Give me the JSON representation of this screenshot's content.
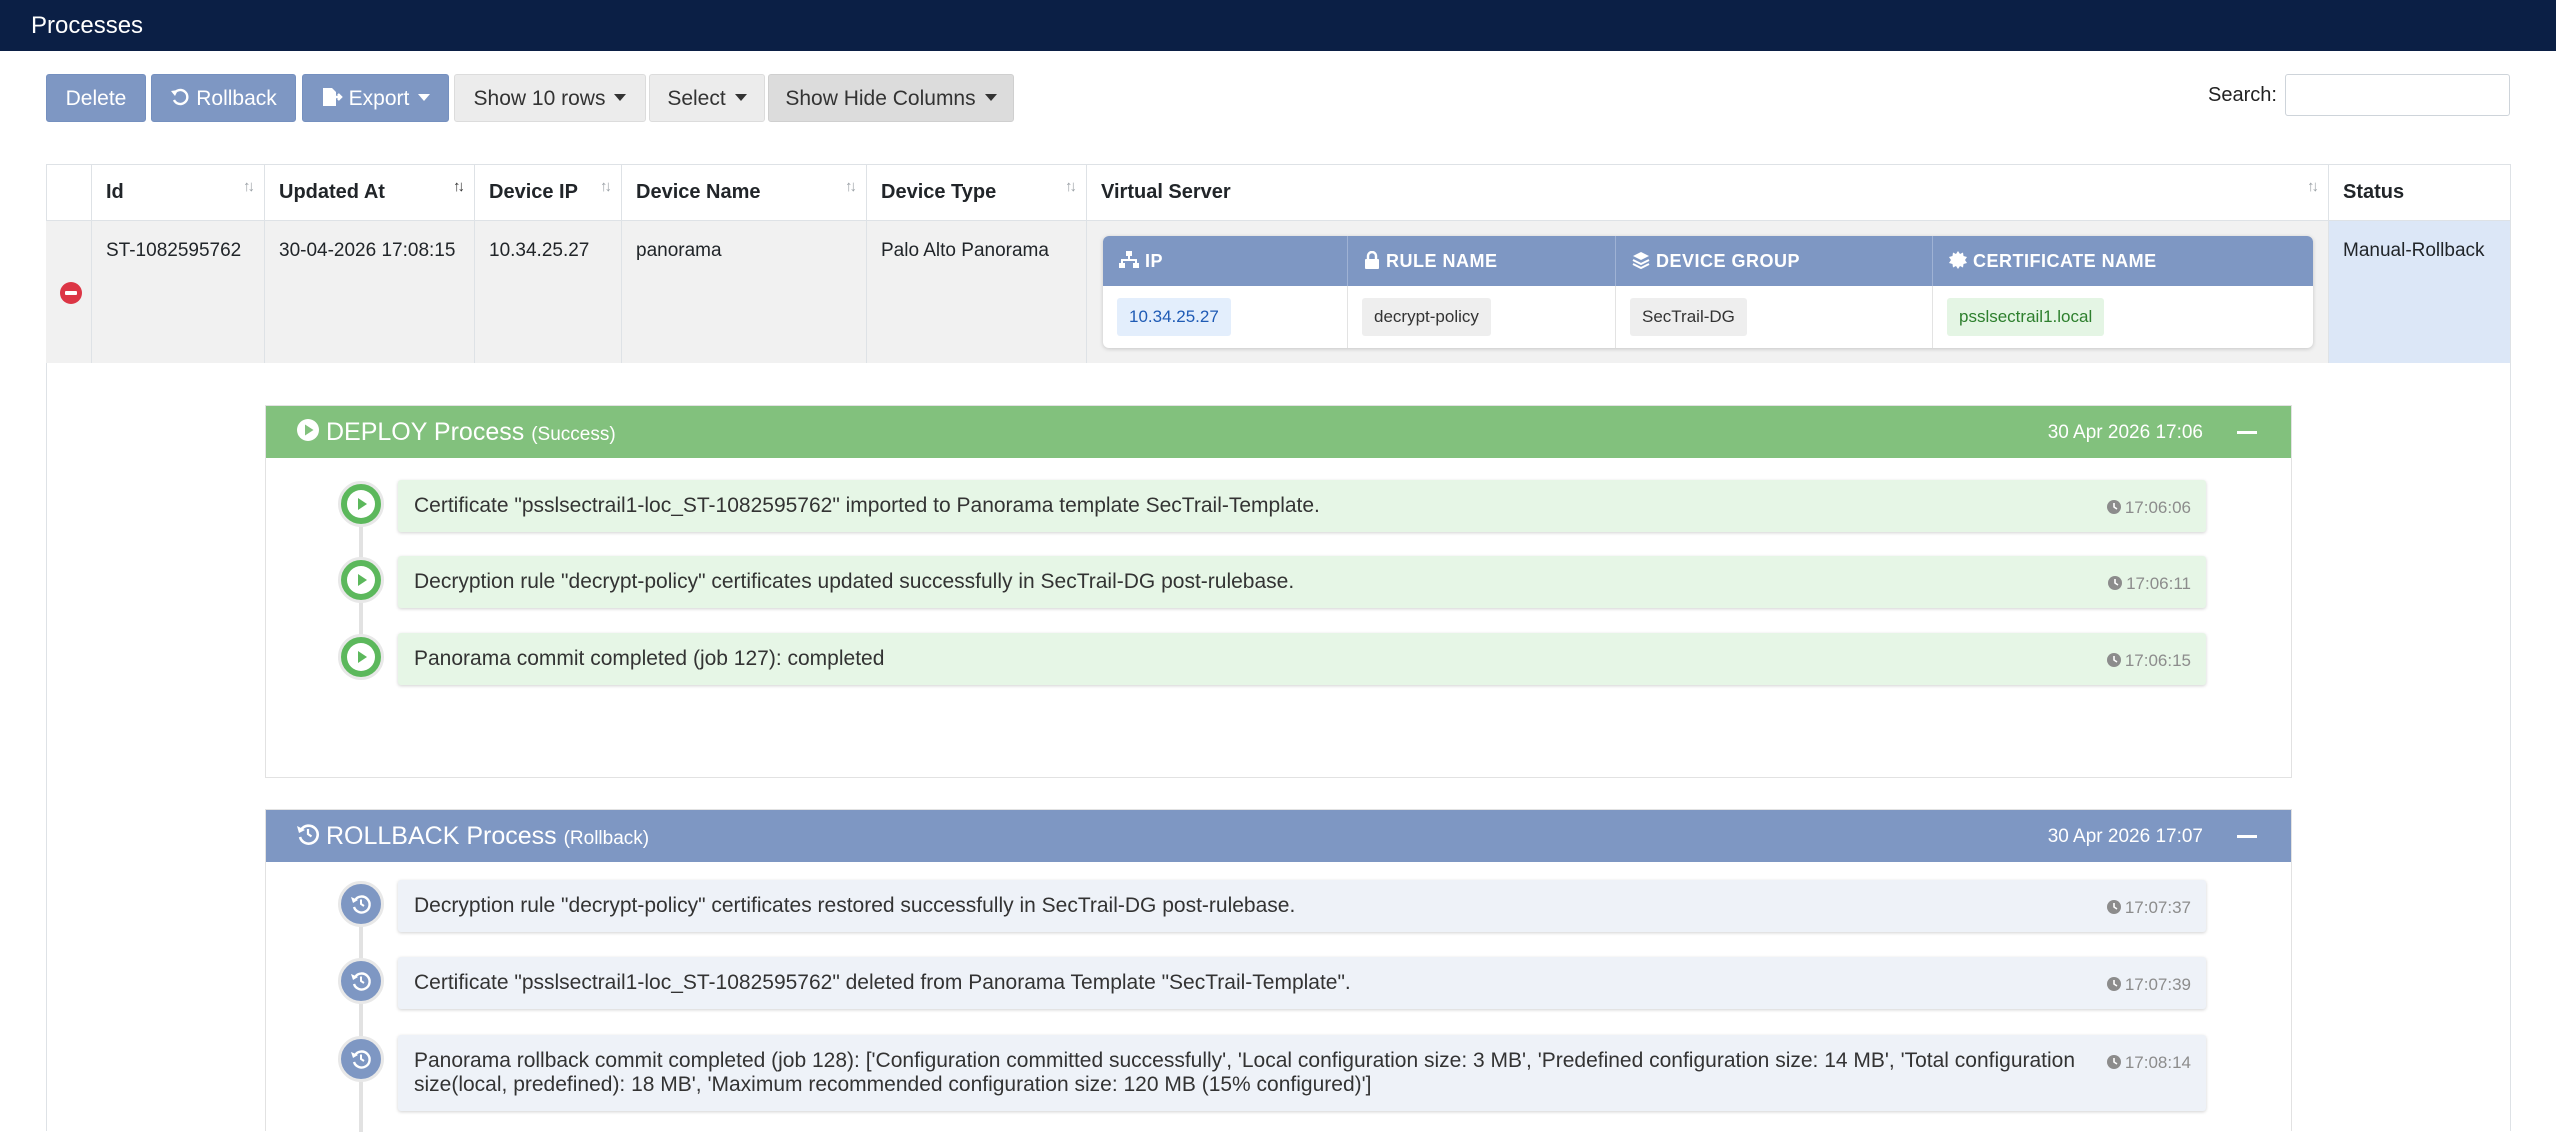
{
  "page": {
    "title": "Processes"
  },
  "toolbar": {
    "delete": "Delete",
    "rollback": "Rollback",
    "export": "Export",
    "show_rows": "Show 10 rows",
    "select": "Select",
    "show_hide_columns": "Show Hide Columns",
    "search_label": "Search:",
    "search_value": ""
  },
  "table": {
    "headers": [
      "Id",
      "Updated At",
      "Device IP",
      "Device Name",
      "Device Type",
      "Virtual Server",
      "Status"
    ],
    "row": {
      "id": "ST-1082595762",
      "updated_at": "30-04-2026 17:08:15",
      "device_ip": "10.34.25.27",
      "device_name": "panorama",
      "device_type": "Palo Alto Panorama",
      "status": "Manual-Rollback"
    },
    "virtual_server": {
      "headers": [
        "IP",
        "RULE NAME",
        "DEVICE GROUP",
        "CERTIFICATE NAME"
      ],
      "ip": "10.34.25.27",
      "rule_name": "decrypt-policy",
      "device_group": "SecTrail-DG",
      "certificate_name": "psslsectrail1.local"
    }
  },
  "colors": {
    "header_bg": "#0b1f45",
    "deploy_green": "#82c17d",
    "rollback_blue": "#7e97c3",
    "danger": "#dc3545"
  },
  "deploy": {
    "title": "DEPLOY Process",
    "status": "(Success)",
    "date": "30 Apr 2026 17:06",
    "icon": "play-circle-icon",
    "events": [
      {
        "message": "Certificate \"psslsectrail1-loc_ST-1082595762\" imported to Panorama template SecTrail-Template.",
        "time": "17:06:06"
      },
      {
        "message": "Decryption rule \"decrypt-policy\" certificates updated successfully in SecTrail-DG post-rulebase.",
        "time": "17:06:11"
      },
      {
        "message": "Panorama commit completed (job 127): completed",
        "time": "17:06:15"
      }
    ]
  },
  "rollback": {
    "title": "ROLLBACK Process",
    "status": "(Rollback)",
    "date": "30 Apr 2026 17:07",
    "icon": "history-icon",
    "events": [
      {
        "message": "Decryption rule \"decrypt-policy\" certificates restored successfully in SecTrail-DG post-rulebase.",
        "time": "17:07:37"
      },
      {
        "message": "Certificate \"psslsectrail1-loc_ST-1082595762\" deleted from Panorama Template \"SecTrail-Template\".",
        "time": "17:07:39"
      },
      {
        "message": "Panorama rollback commit completed (job 128): ['Configuration committed successfully', 'Local configuration size: 3 MB', 'Predefined configuration size: 14 MB', 'Total configuration size(local, predefined): 18 MB', 'Maximum recommended configuration size: 120 MB (15% configured)']",
        "time": "17:08:14"
      }
    ]
  }
}
